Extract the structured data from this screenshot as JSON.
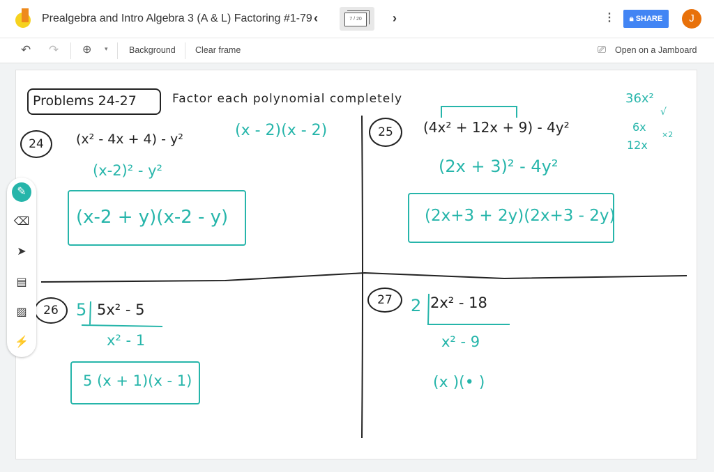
{
  "header": {
    "title": "Prealgebra and Intro Algebra 3 (A & L) Factoring #1-79",
    "frame_indicator": "7 / 20",
    "share_label": "SHARE",
    "avatar_initial": "J"
  },
  "toolbar": {
    "background_label": "Background",
    "clear_frame_label": "Clear frame",
    "open_jamboard_label": "Open on a Jamboard"
  },
  "tools": [
    "pen",
    "eraser",
    "select",
    "sticky-note",
    "image",
    "laser"
  ],
  "colors": {
    "accent": "#26b5aa",
    "share": "#4285f4",
    "avatar": "#e8710a"
  },
  "board": {
    "heading": "Problems 24-27",
    "instruction": "Factor each polynomial completely",
    "p24": {
      "num": "24",
      "expr": "(x² - 4x + 4) - y²",
      "side": "(x - 2)(x - 2)",
      "step": "(x-2)² - y²",
      "answer": "(x-2 + y)(x-2 - y)"
    },
    "p25": {
      "num": "25",
      "expr": "(4x² + 12x + 9) - 4y²",
      "step": "(2x + 3)² - 4y²",
      "answer": "(2x+3 + 2y)(2x+3 - 2y)",
      "note1": "36x²",
      "note2": "6x",
      "note3": "12x",
      "note4": "√",
      "note5": "×2"
    },
    "p26": {
      "num": "26",
      "factor": "5",
      "expr": "5x² - 5",
      "quotient": "x² - 1",
      "answer": "5 (x + 1)(x - 1)"
    },
    "p27": {
      "num": "27",
      "factor": "2",
      "expr": "2x² - 18",
      "quotient": "x² - 9",
      "partial": "(x    )(•    )"
    }
  }
}
